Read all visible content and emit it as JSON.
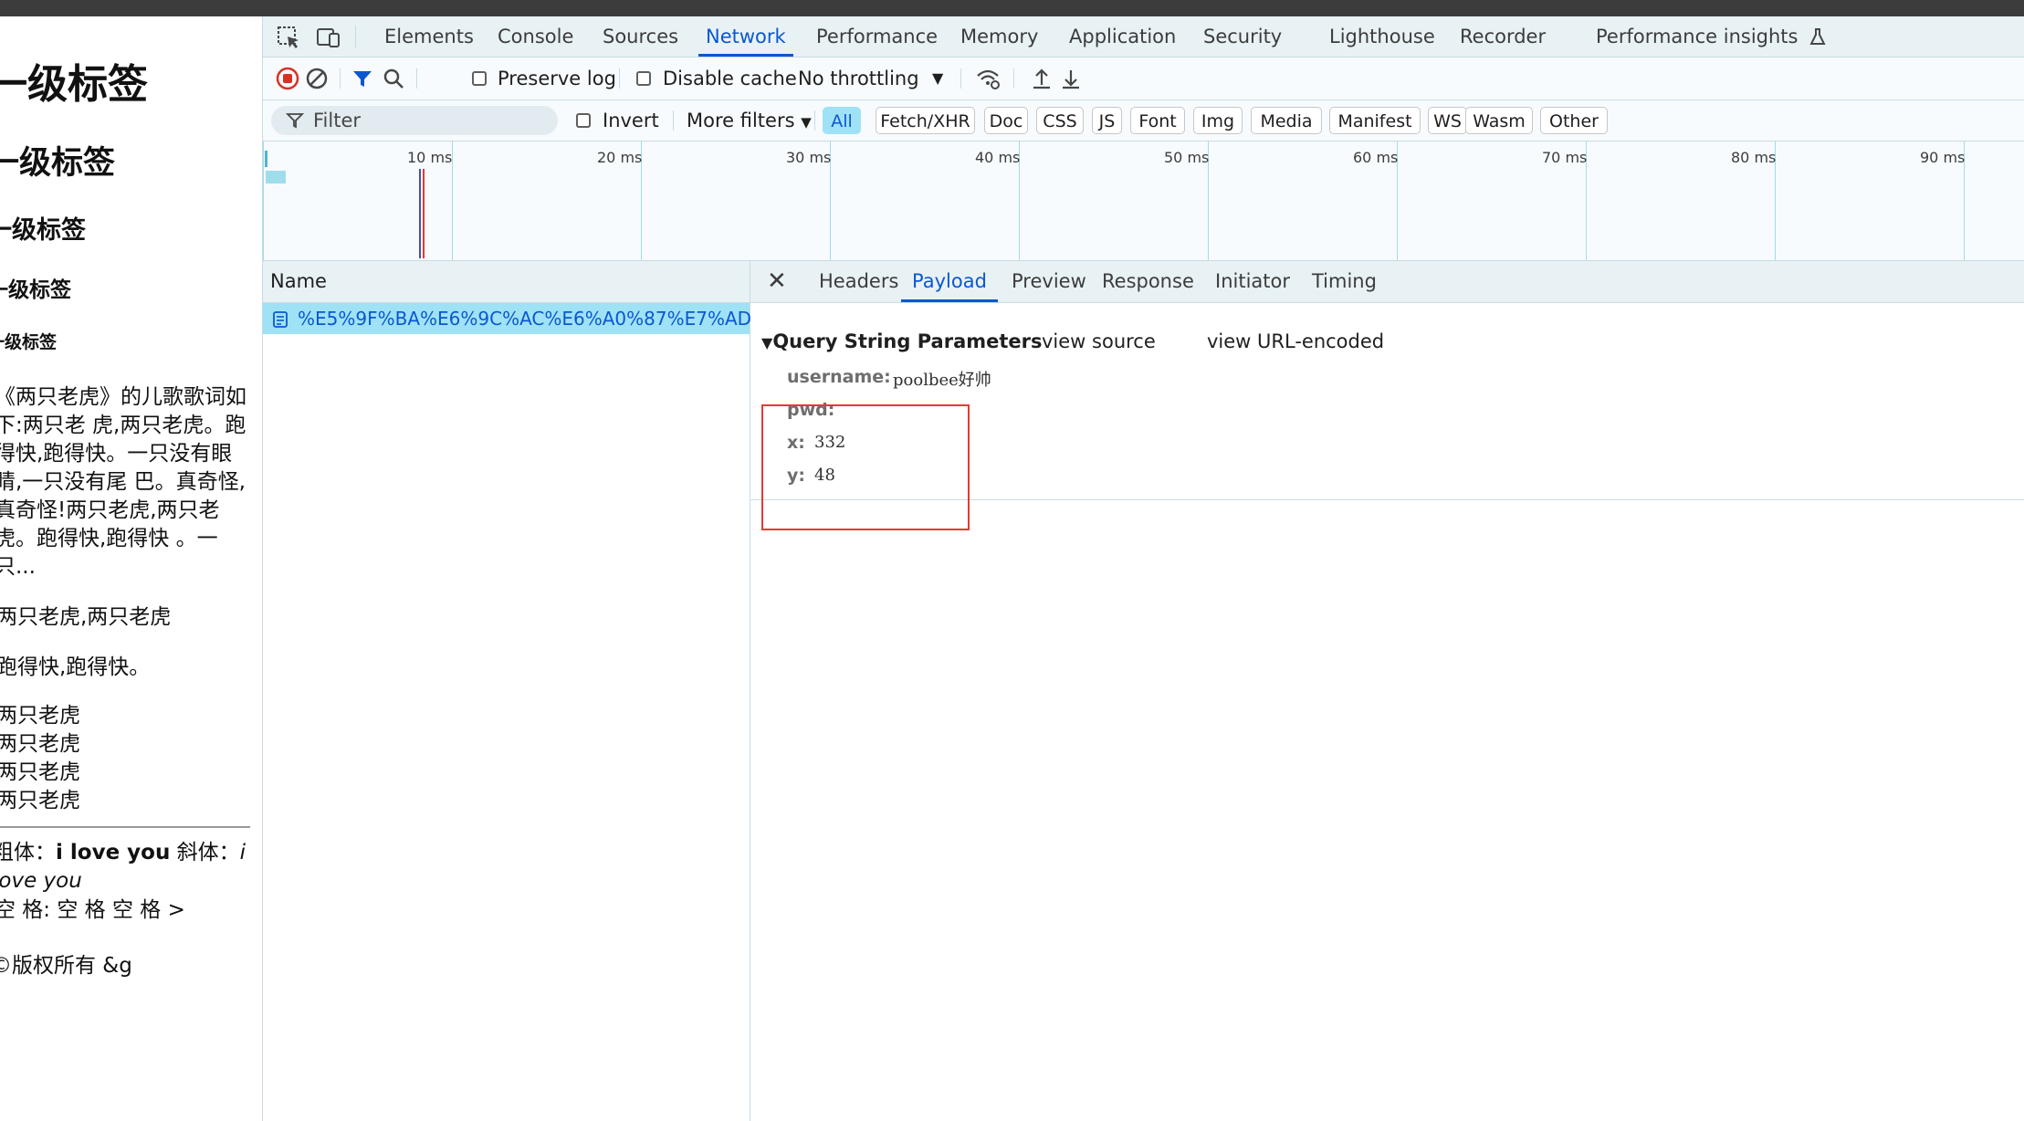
{
  "page": {
    "headings": [
      "一级标签",
      "一级标签",
      "一级标签",
      "一级标签",
      "一级标签"
    ],
    "paragraph": "《两只老虎》的儿歌歌词如\n下:两只老 虎,两只老虎。跑\n得快,跑得快。一只没有眼\n睛,一只没有尾 巴。真奇怪,\n真奇怪!两只老虎,两只老\n虎。跑得快,跑得快 。一\n只...",
    "line1": "两只老虎,两只老虎",
    "line2": "跑得快,跑得快。",
    "list": [
      "两只老虎",
      "两只老虎",
      "两只老虎",
      "两只老虎"
    ],
    "bold_label": "粗体：",
    "bold_text": "i love you",
    "italic_label": " 斜体：",
    "italic_text": "i love you",
    "space_line": "空 格:   空 格 空     格 >",
    "copyright": "©版权所有 &g"
  },
  "devtools": {
    "tabs": [
      "Elements",
      "Console",
      "Sources",
      "Network",
      "Performance",
      "Memory",
      "Application",
      "Security",
      "Lighthouse",
      "Recorder",
      "Performance insights"
    ],
    "active_tab": "Network",
    "toolbar": {
      "preserve_log": "Preserve log",
      "disable_cache": "Disable cache",
      "throttling": "No throttling"
    },
    "filter": {
      "placeholder": "Filter",
      "invert": "Invert",
      "more_filters": "More filters",
      "types": [
        "All",
        "Fetch/XHR",
        "Doc",
        "CSS",
        "JS",
        "Font",
        "Img",
        "Media",
        "Manifest",
        "WS",
        "Wasm",
        "Other"
      ]
    },
    "timeline": {
      "ticks": [
        "10 ms",
        "20 ms",
        "30 ms",
        "40 ms",
        "50 ms",
        "60 ms",
        "70 ms",
        "80 ms",
        "90 ms"
      ]
    },
    "requests": {
      "column": "Name",
      "rows": [
        "%E5%9F%BA%E6%9C%AC%E6%A0%87%E7%AD..."
      ]
    },
    "detail": {
      "tabs": [
        "Headers",
        "Payload",
        "Preview",
        "Response",
        "Initiator",
        "Timing"
      ],
      "active_tab": "Payload",
      "section_title": "Query String Parameters",
      "view_source": "view source",
      "view_encoded": "view URL-encoded",
      "params": [
        {
          "key": "username:",
          "value": "poolbee好帅"
        },
        {
          "key": "pwd:",
          "value": ""
        },
        {
          "key": "x:",
          "value": "332"
        },
        {
          "key": "y:",
          "value": "48"
        }
      ]
    }
  },
  "colors": {
    "accent": "#0b57d0",
    "highlight_border": "#e53935",
    "selected_row": "#9fe2f5"
  }
}
